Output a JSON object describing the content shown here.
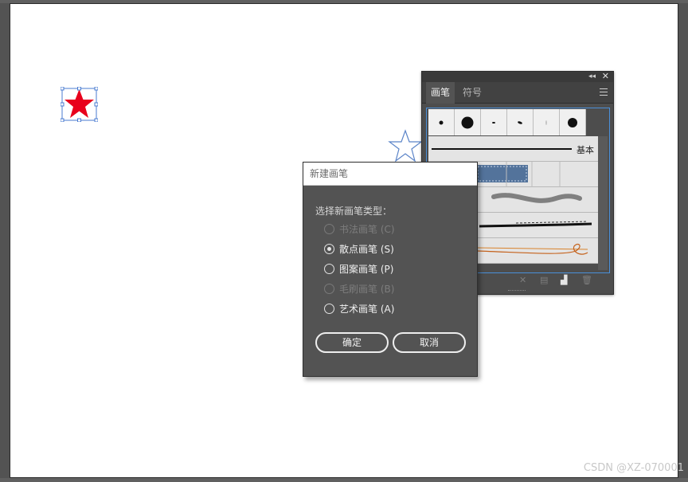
{
  "canvas": {
    "selected_star_color": "#e8001c",
    "selection_color": "#4a7bd1"
  },
  "brushes_panel": {
    "tabs": [
      {
        "label": "画笔",
        "active": true
      },
      {
        "label": "符号",
        "active": false
      }
    ],
    "basic_brush_label": "基本",
    "collapse_glyph": "◂◂",
    "close_glyph": "✕"
  },
  "new_brush_dialog": {
    "title": "新建画笔",
    "prompt": "选择新画笔类型：",
    "options": [
      {
        "label": "书法画笔 (C)",
        "enabled": false,
        "selected": false
      },
      {
        "label": "散点画笔 (S)",
        "enabled": true,
        "selected": true
      },
      {
        "label": "图案画笔 (P)",
        "enabled": true,
        "selected": false
      },
      {
        "label": "毛刷画笔 (B)",
        "enabled": false,
        "selected": false
      },
      {
        "label": "艺术画笔 (A)",
        "enabled": true,
        "selected": false
      }
    ],
    "ok_label": "确定",
    "cancel_label": "取消"
  },
  "watermark": "CSDN @XZ-070001"
}
